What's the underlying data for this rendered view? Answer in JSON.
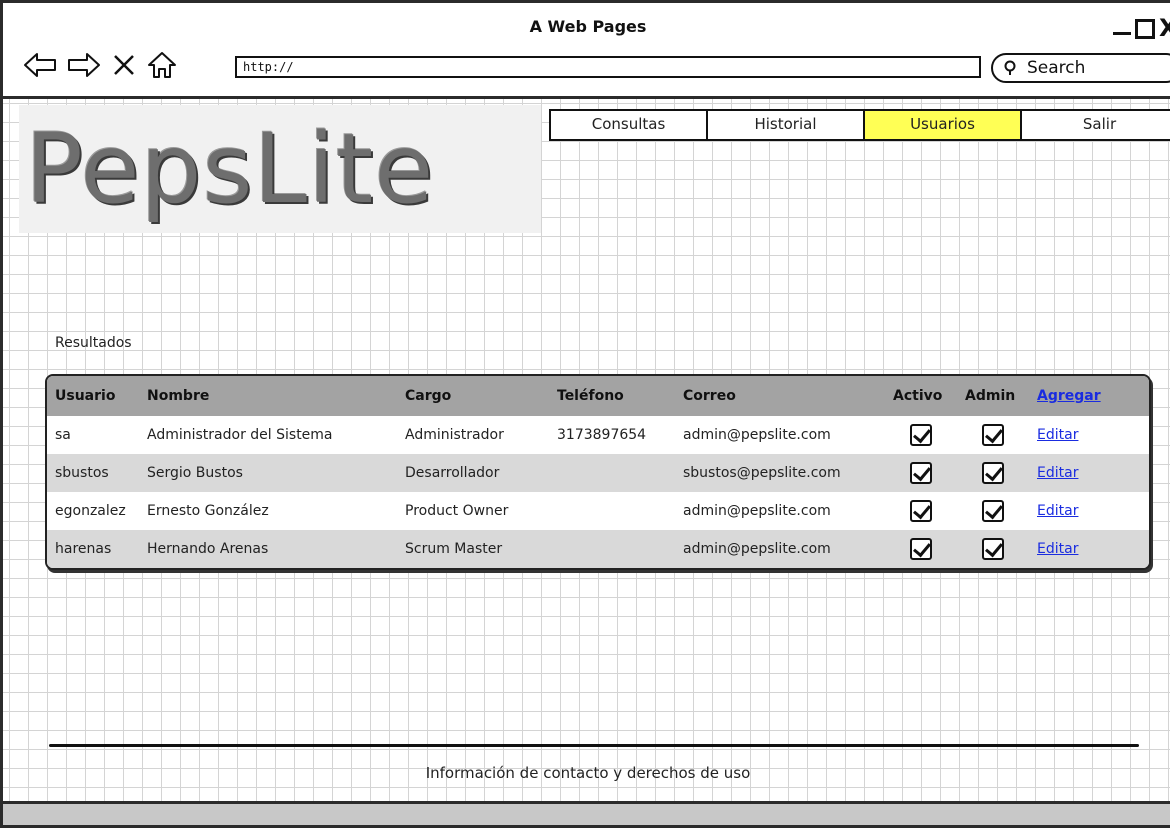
{
  "window": {
    "title": "A Web Pages"
  },
  "browser": {
    "url": "http://",
    "search_placeholder": "Search"
  },
  "logo": {
    "text": "PepsLite"
  },
  "menu": {
    "items": [
      {
        "label": "Consultas"
      },
      {
        "label": "Historial"
      },
      {
        "label": "Usuarios",
        "active": true,
        "active_color": "#ffff55"
      },
      {
        "label": "Salir"
      }
    ]
  },
  "results": {
    "label": "Resultados",
    "columns": [
      "Usuario",
      "Nombre",
      "Cargo",
      "Teléfono",
      "Correo",
      "Activo",
      "Admin"
    ],
    "add_link": "Agregar",
    "rows": [
      {
        "usuario": "sa",
        "nombre": "Administrador del Sistema",
        "cargo": "Administrador",
        "telefono": "3173897654",
        "correo": "admin@pepslite.com",
        "activo": true,
        "admin": true,
        "action": "Editar"
      },
      {
        "usuario": "sbustos",
        "nombre": "Sergio Bustos",
        "cargo": "Desarrollador",
        "telefono": "",
        "correo": "sbustos@pepslite.com",
        "activo": true,
        "admin": true,
        "action": "Editar"
      },
      {
        "usuario": "egonzalez",
        "nombre": "Ernesto González",
        "cargo": "Product Owner",
        "telefono": "",
        "correo": "admin@pepslite.com",
        "activo": true,
        "admin": true,
        "action": "Editar"
      },
      {
        "usuario": "harenas",
        "nombre": "Hernando Arenas",
        "cargo": "Scrum Master",
        "telefono": "",
        "correo": "admin@pepslite.com",
        "activo": true,
        "admin": true,
        "action": "Editar"
      }
    ]
  },
  "footer": {
    "text": "Información de contacto y derechos de uso"
  },
  "colors": {
    "header_bg": "#a3a3a3",
    "row_alt_bg": "#d9d9d9",
    "link": "#1a2ce0"
  }
}
